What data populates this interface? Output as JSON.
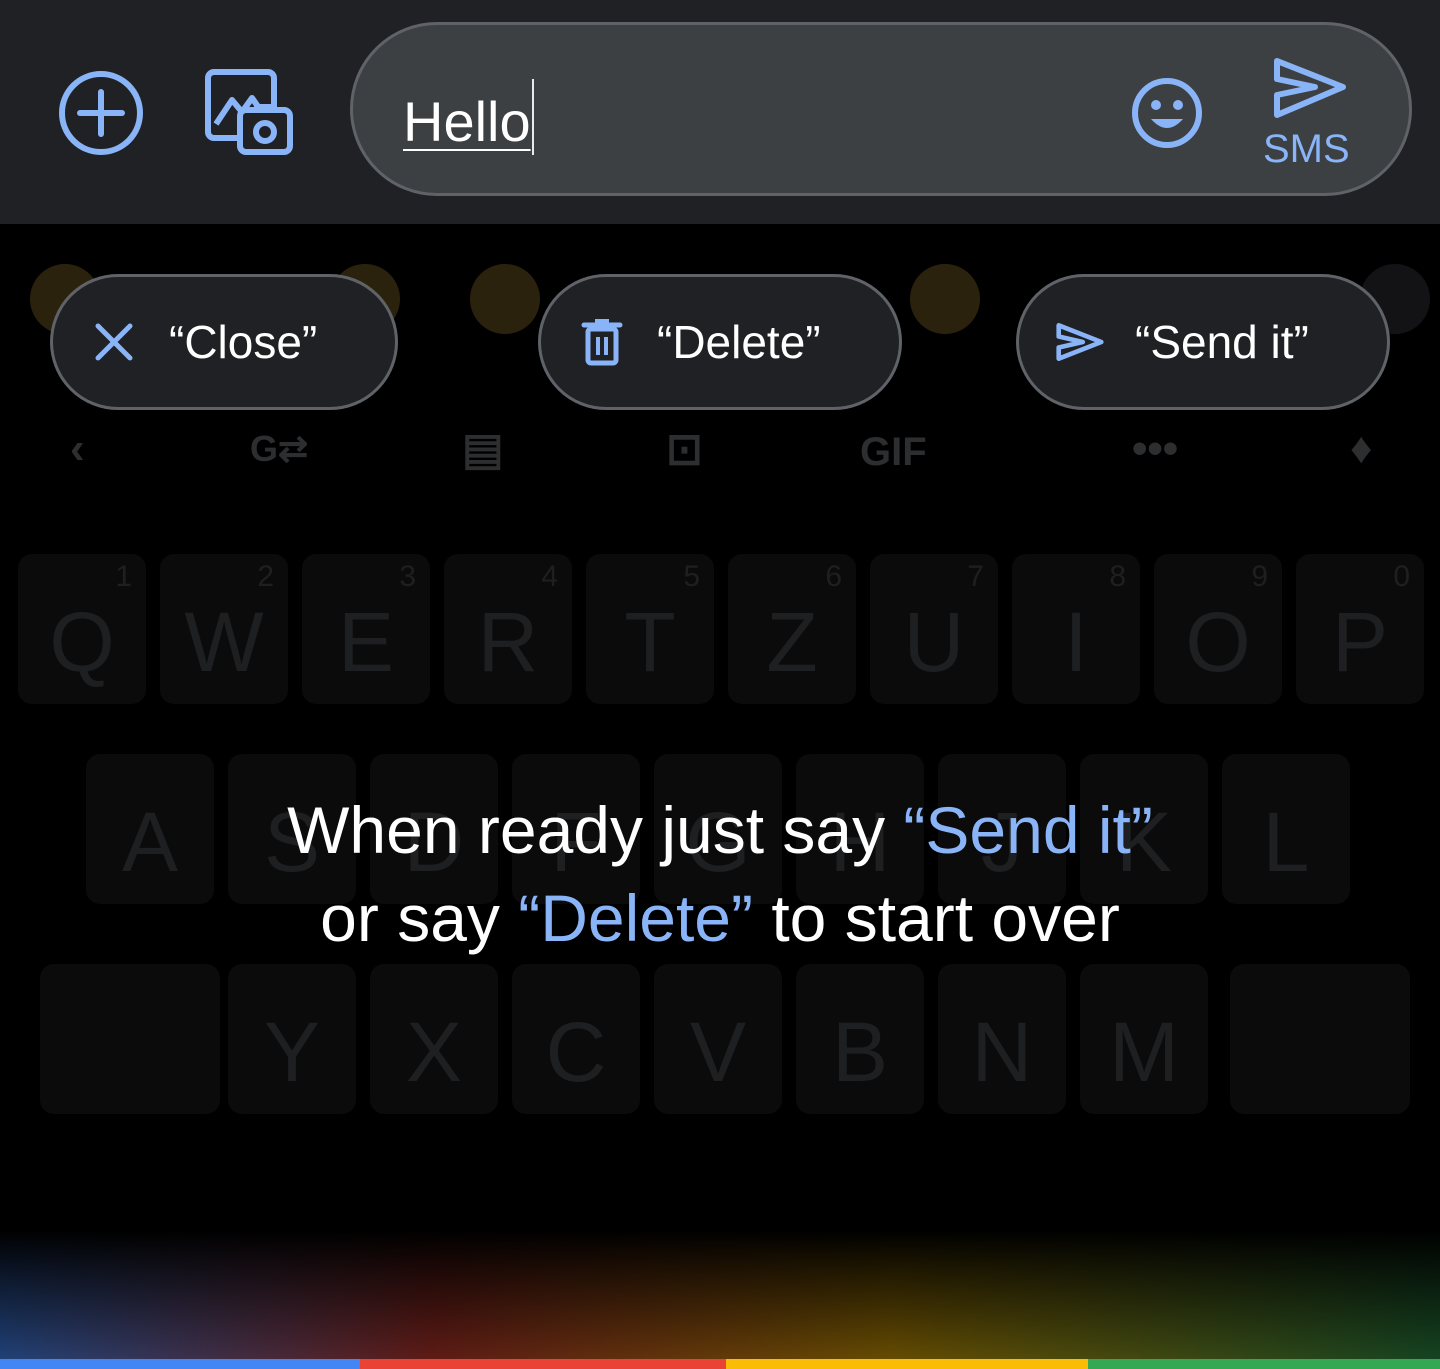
{
  "compose": {
    "text": "Hello",
    "send_label": "SMS"
  },
  "chips": [
    {
      "label": "“Close”",
      "icon": "close-icon"
    },
    {
      "label": "“Delete”",
      "icon": "trash-icon"
    },
    {
      "label": "“Send it”",
      "icon": "send-icon"
    }
  ],
  "hint": {
    "line1_prefix": "When ready just say ",
    "line1_command": "“Send it”",
    "line2_prefix": "or say ",
    "line2_command": "“Delete”",
    "line2_suffix": " to start over"
  },
  "keyboard": {
    "row1": [
      "Q",
      "W",
      "E",
      "R",
      "T",
      "Z",
      "U",
      "I",
      "O",
      "P"
    ],
    "row1_numbers": [
      "1",
      "2",
      "3",
      "4",
      "5",
      "6",
      "7",
      "8",
      "9",
      "0"
    ],
    "row2": [
      "A",
      "S",
      "D",
      "F",
      "G",
      "H",
      "J",
      "K",
      "L"
    ],
    "row3": [
      "Y",
      "X",
      "C",
      "V",
      "B",
      "N",
      "M"
    ],
    "toolbar_gif": "GIF"
  },
  "colors": {
    "accent": "#8ab4f8",
    "google_blue": "#4285f4",
    "google_red": "#ea4335",
    "google_yellow": "#fbbc05",
    "google_green": "#34a853"
  }
}
